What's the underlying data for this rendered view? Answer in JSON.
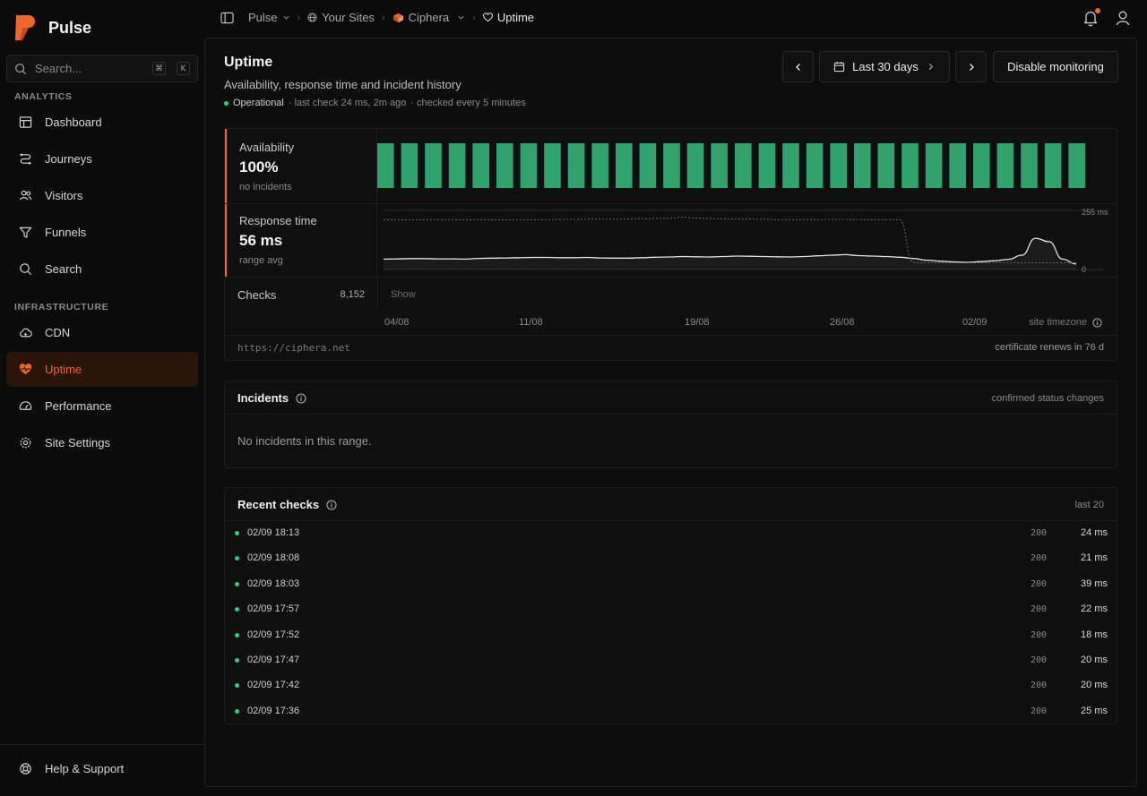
{
  "brand": {
    "name": "Pulse",
    "logo_color": "#f3662a"
  },
  "search": {
    "placeholder": "Search...",
    "kbd": [
      "⌘",
      "K"
    ]
  },
  "sidebar": {
    "section_analytics": "ANALYTICS",
    "section_infrastructure": "INFRASTRUCTURE",
    "items": [
      {
        "label": "Dashboard",
        "icon": "layout-icon"
      },
      {
        "label": "Journeys",
        "icon": "route-icon"
      },
      {
        "label": "Visitors",
        "icon": "users-icon"
      },
      {
        "label": "Funnels",
        "icon": "funnel-icon"
      },
      {
        "label": "Search",
        "icon": "search-icon"
      },
      {
        "label": "CDN",
        "icon": "cloud-icon"
      },
      {
        "label": "Uptime",
        "icon": "heart-pulse-icon",
        "active": true
      },
      {
        "label": "Performance",
        "icon": "gauge-icon"
      },
      {
        "label": "Site Settings",
        "icon": "gear-icon"
      }
    ],
    "help": "Help & Support"
  },
  "breadcrumb": {
    "org": "Pulse",
    "sites": "Your Sites",
    "site": "Ciphera",
    "page": "Uptime"
  },
  "page": {
    "title": "Uptime",
    "subtitle": "Availability, response time and incident history",
    "status": "Operational",
    "last_check": "· last check 24 ms, 2m ago",
    "interval": "· checked every 5 minutes"
  },
  "controls": {
    "range_label": "Last 30 days",
    "disable_label": "Disable monitoring"
  },
  "uptime": {
    "availability_label": "Availability",
    "availability_value": "100%",
    "availability_sub": "no incidents",
    "response_label": "Response time",
    "response_value": "56 ms",
    "response_sub": "range avg",
    "checks_label": "Checks",
    "checks_count": "8,152",
    "show_label": "Show",
    "x_ticks": [
      "04/08",
      "11/08",
      "19/08",
      "26/08",
      "02/09"
    ],
    "timezone_label": "site timezone",
    "url": "https://ciphera.net",
    "cert": "certificate renews in 76 d",
    "bar_count": 30,
    "bar_color": "#2fa36b",
    "y_max_label": "255 ms",
    "y_min_label": "0"
  },
  "chart_data": {
    "type": "line",
    "title": "Response time",
    "ylim": [
      0,
      255
    ],
    "series": [
      {
        "values": [
          45,
          46,
          47,
          47,
          46,
          46,
          45,
          48,
          49,
          50,
          51,
          52,
          52,
          51,
          51,
          52,
          50,
          49,
          49,
          51,
          53,
          54,
          56,
          55,
          54,
          56,
          58,
          57,
          56,
          55,
          54,
          56,
          59,
          62,
          64,
          60,
          58,
          56,
          53,
          48,
          40,
          36,
          33,
          31,
          34,
          38,
          44,
          62,
          135,
          120,
          45,
          24
        ]
      },
      {
        "values": [
          215,
          214,
          214,
          215,
          215,
          215,
          214,
          215,
          215,
          214,
          214,
          215,
          215,
          216,
          216,
          217,
          217,
          218,
          218,
          219,
          220,
          221,
          226,
          222,
          220,
          219,
          218,
          218,
          217,
          215,
          215,
          215,
          215,
          216,
          216,
          215,
          215,
          215,
          215,
          30,
          29,
          29,
          29,
          29,
          29,
          30,
          30,
          29,
          29,
          29,
          29,
          29
        ]
      }
    ]
  },
  "incidents": {
    "title": "Incidents",
    "right": "confirmed status changes",
    "empty": "No incidents in this range."
  },
  "recent_checks": {
    "title": "Recent checks",
    "right": "last 20",
    "rows": [
      {
        "time": "02/09 18:13",
        "code": "200",
        "ms": "24 ms"
      },
      {
        "time": "02/09 18:08",
        "code": "200",
        "ms": "21 ms"
      },
      {
        "time": "02/09 18:03",
        "code": "200",
        "ms": "39 ms"
      },
      {
        "time": "02/09 17:57",
        "code": "200",
        "ms": "22 ms"
      },
      {
        "time": "02/09 17:52",
        "code": "200",
        "ms": "18 ms"
      },
      {
        "time": "02/09 17:47",
        "code": "200",
        "ms": "20 ms"
      },
      {
        "time": "02/09 17:42",
        "code": "200",
        "ms": "20 ms"
      },
      {
        "time": "02/09 17:36",
        "code": "200",
        "ms": "25 ms"
      }
    ]
  }
}
